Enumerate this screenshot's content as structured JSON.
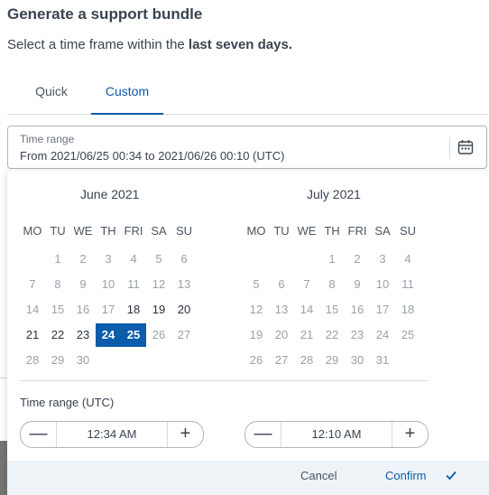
{
  "dialog": {
    "title": "Generate a support bundle",
    "subtitle_prefix": "Select a time frame within the ",
    "subtitle_bold": "last seven days."
  },
  "tabs": [
    {
      "label": "Quick",
      "active": false
    },
    {
      "label": "Custom",
      "active": true
    }
  ],
  "range_field": {
    "label": "Time range",
    "value": "From 2021/06/25 00:34 to 2021/06/26 00:10 (UTC)",
    "icon": "calendar-icon"
  },
  "weekdays": [
    "MO",
    "TU",
    "WE",
    "TH",
    "FRI",
    "SA",
    "SU"
  ],
  "months": [
    {
      "title": "June 2021",
      "first_weekday_index": 1,
      "days_in_month": 30,
      "enabled_days": [
        18,
        19,
        20,
        21,
        22,
        23,
        24,
        25
      ],
      "selected_days": [
        24,
        25
      ]
    },
    {
      "title": "July 2021",
      "first_weekday_index": 3,
      "days_in_month": 31,
      "enabled_days": [],
      "selected_days": []
    }
  ],
  "time_range": {
    "label": "Time range (UTC)",
    "start_time": "12:34 AM",
    "end_time": "12:10 AM",
    "minus_symbol": "—",
    "plus_symbol": "+"
  },
  "footer": {
    "cancel_label": "Cancel",
    "confirm_label": "Confirm"
  },
  "colors": {
    "accent": "#0b5cab",
    "footer_bg": "#eef3f8"
  }
}
